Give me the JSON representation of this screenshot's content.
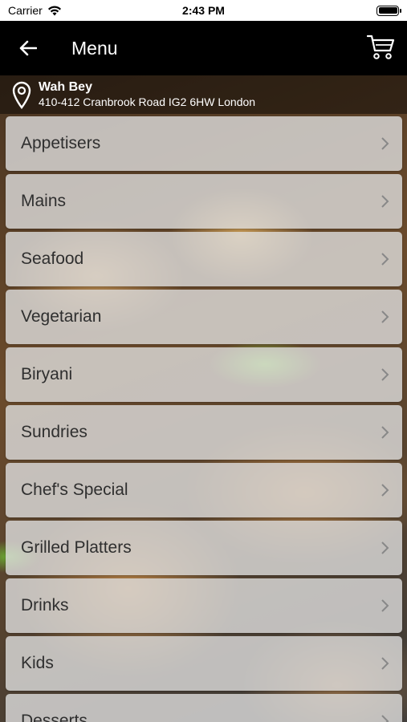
{
  "status_bar": {
    "carrier": "Carrier",
    "time": "2:43 PM"
  },
  "nav": {
    "title": "Menu",
    "back_icon": "back-arrow-icon",
    "cart_icon": "cart-icon"
  },
  "location": {
    "name": "Wah Bey",
    "address": "410-412 Cranbrook Road IG2 6HW London"
  },
  "menu": {
    "items": [
      {
        "label": "Appetisers"
      },
      {
        "label": "Mains"
      },
      {
        "label": "Seafood"
      },
      {
        "label": "Vegetarian"
      },
      {
        "label": "Biryani"
      },
      {
        "label": "Sundries"
      },
      {
        "label": "Chef's Special"
      },
      {
        "label": "Grilled Platters"
      },
      {
        "label": "Drinks"
      },
      {
        "label": "Kids"
      },
      {
        "label": "Desserts"
      }
    ]
  }
}
